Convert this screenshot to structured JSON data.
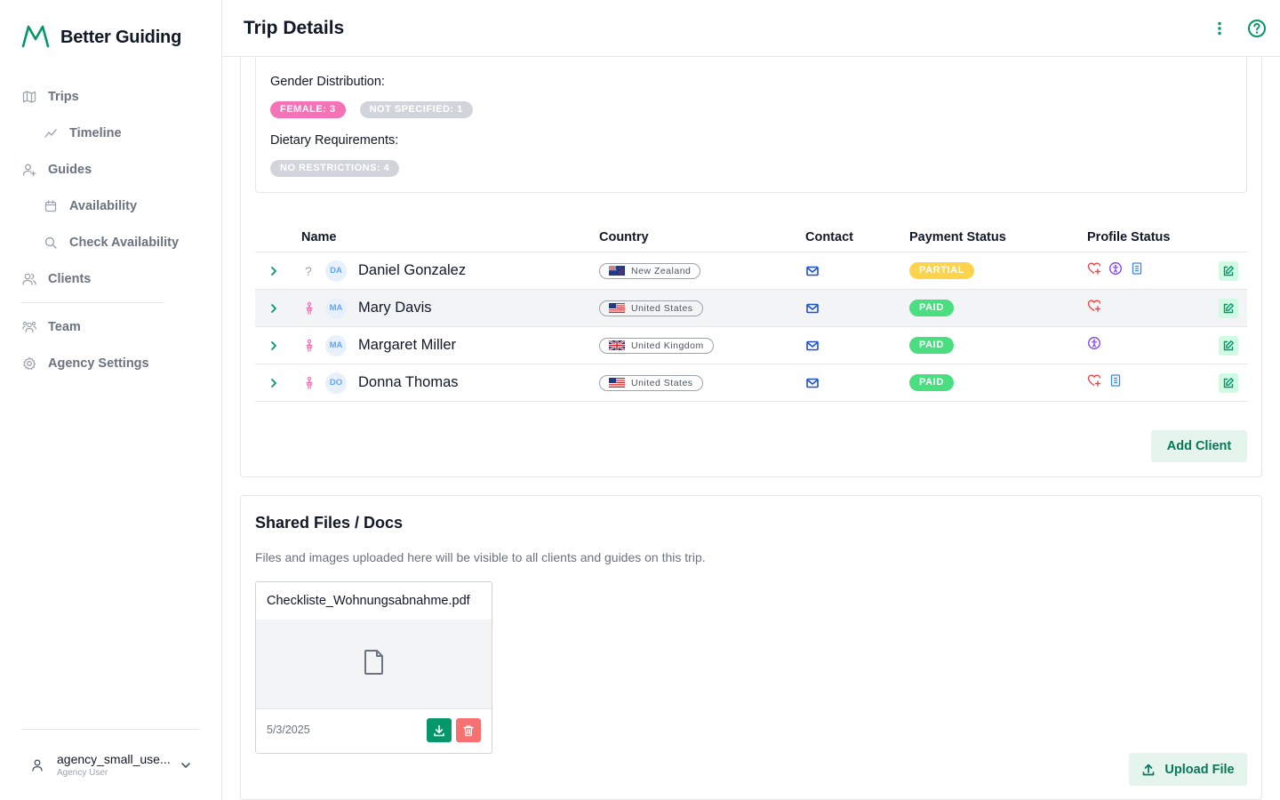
{
  "brand": {
    "name": "Better Guiding",
    "logo": "mountain-logo-icon",
    "accent": "#059669"
  },
  "nav": {
    "trips": "Trips",
    "timeline": "Timeline",
    "guides": "Guides",
    "availability": "Availability",
    "check_availability": "Check Availability",
    "clients": "Clients",
    "team": "Team",
    "agency_settings": "Agency Settings"
  },
  "user": {
    "name": "agency_small_use...",
    "role": "Agency User"
  },
  "header": {
    "title": "Trip Details"
  },
  "summary": {
    "gender_label": "Gender Distribution:",
    "gender_chips": [
      {
        "label": "FEMALE: 3",
        "color": "#f472b6"
      },
      {
        "label": "NOT SPECIFIED: 1",
        "color": "#d1d5db"
      }
    ],
    "dietary_label": "Dietary Requirements:",
    "dietary_chips": [
      {
        "label": "NO RESTRICTIONS: 4",
        "color": "#d1d5db"
      }
    ]
  },
  "table": {
    "headers": {
      "name": "Name",
      "country": "Country",
      "contact": "Contact",
      "payment": "Payment Status",
      "profile": "Profile Status"
    },
    "rows": [
      {
        "initials": "DA",
        "name": "Daniel Gonzalez",
        "gender_icon": "question-mark-icon",
        "country": "New Zealand",
        "payment": "PARTIAL",
        "payment_color": "#fcd34d",
        "profile_icons": [
          "heart-plus-icon",
          "accessibility-icon",
          "document-icon"
        ]
      },
      {
        "initials": "MA",
        "name": "Mary Davis",
        "gender_icon": "female-icon",
        "country": "United States",
        "payment": "PAID",
        "payment_color": "#4ade80",
        "profile_icons": [
          "heart-plus-icon"
        ]
      },
      {
        "initials": "MA",
        "name": "Margaret Miller",
        "gender_icon": "female-icon",
        "country": "United Kingdom",
        "payment": "PAID",
        "payment_color": "#4ade80",
        "profile_icons": [
          "accessibility-icon"
        ]
      },
      {
        "initials": "DO",
        "name": "Donna Thomas",
        "gender_icon": "female-icon",
        "country": "United States",
        "payment": "PAID",
        "payment_color": "#4ade80",
        "profile_icons": [
          "heart-plus-icon",
          "document-icon"
        ]
      }
    ]
  },
  "actions": {
    "add_client": "Add Client",
    "upload_file": "Upload File"
  },
  "files": {
    "title": "Shared Files / Docs",
    "description": "Files and images uploaded here will be visible to all clients and guides on this trip.",
    "items": [
      {
        "name": "Checkliste_Wohnungsabnahme.pdf",
        "date": "5/3/2025"
      }
    ]
  }
}
